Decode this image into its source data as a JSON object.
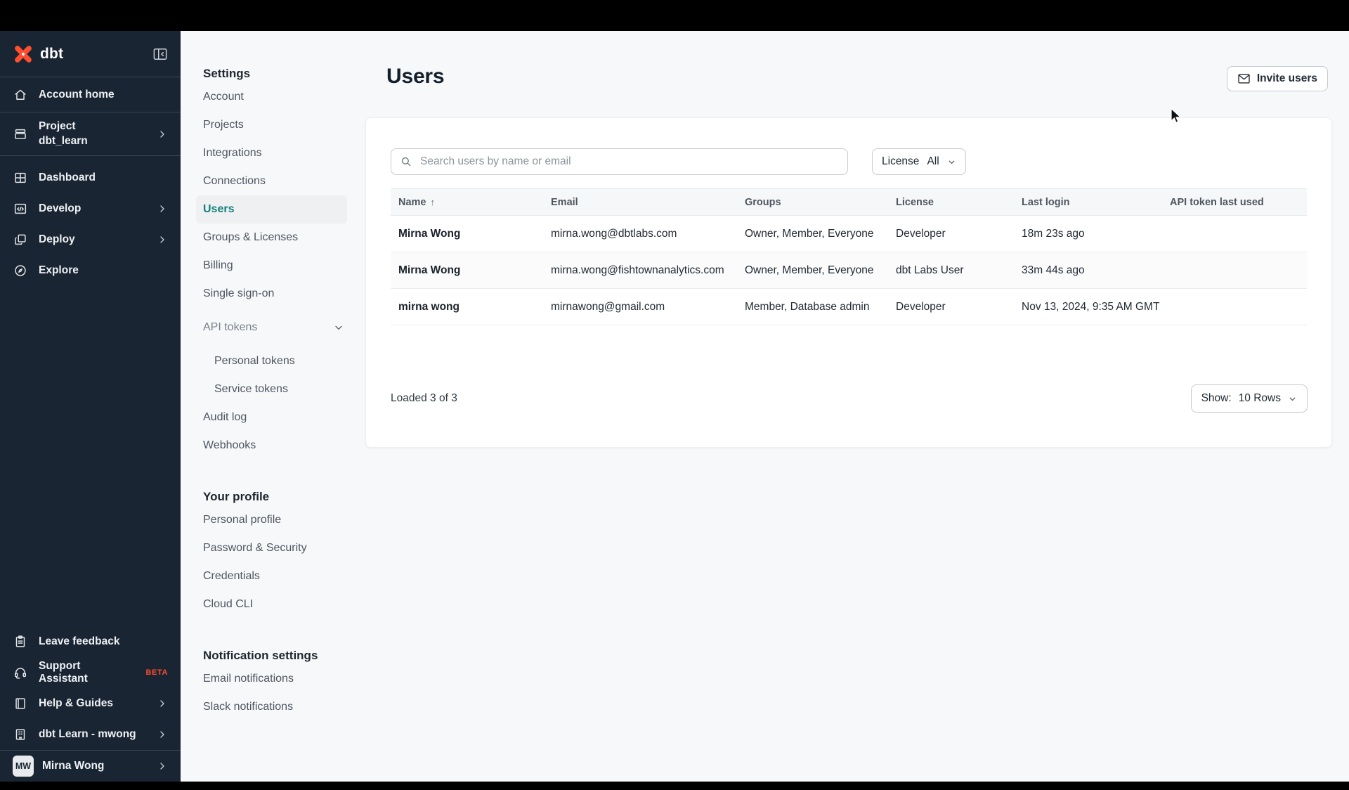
{
  "sidebar": {
    "logo_text": "dbt",
    "nav": [
      {
        "label": "Account home",
        "icon": "home"
      },
      {
        "label": "Project",
        "sublabel": "dbt_learn",
        "icon": "archive-box"
      },
      {
        "label": "Dashboard",
        "icon": "grid"
      },
      {
        "label": "Develop",
        "icon": "code-window"
      },
      {
        "label": "Deploy",
        "icon": "stacked-squares"
      },
      {
        "label": "Explore",
        "icon": "compass"
      }
    ],
    "footer_nav": [
      {
        "label": "Leave feedback",
        "icon": "clipboard"
      },
      {
        "label": "Support Assistant",
        "badge": "BETA",
        "icon": "headset"
      },
      {
        "label": "Help & Guides",
        "icon": "book"
      },
      {
        "label": "dbt Learn - mwong",
        "icon": "building"
      }
    ],
    "user": {
      "initials": "MW",
      "name": "Mirna Wong"
    }
  },
  "settings_nav": {
    "sections": [
      {
        "heading": "Settings",
        "items": [
          {
            "label": "Account"
          },
          {
            "label": "Projects"
          },
          {
            "label": "Integrations"
          },
          {
            "label": "Connections"
          },
          {
            "label": "Users",
            "active": true
          },
          {
            "label": "Groups & Licenses"
          },
          {
            "label": "Billing"
          },
          {
            "label": "Single sign-on"
          },
          {
            "label": "API tokens"
          },
          {
            "label": "Personal tokens"
          },
          {
            "label": "Service tokens"
          },
          {
            "label": "Audit log"
          },
          {
            "label": "Webhooks"
          }
        ]
      },
      {
        "heading": "Your profile",
        "items": [
          {
            "label": "Personal profile"
          },
          {
            "label": "Password & Security"
          },
          {
            "label": "Credentials"
          },
          {
            "label": "Cloud CLI"
          }
        ]
      },
      {
        "heading": "Notification settings",
        "items": [
          {
            "label": "Email notifications"
          },
          {
            "label": "Slack notifications"
          }
        ]
      }
    ]
  },
  "main": {
    "title": "Users",
    "invite_button_label": "Invite users",
    "search": {
      "placeholder": "Search users by name or email"
    },
    "license_filter": {
      "label": "License",
      "value": "All"
    },
    "table": {
      "columns": [
        {
          "label": "Name",
          "sort_icon": "↑"
        },
        {
          "label": "Email"
        },
        {
          "label": "Groups"
        },
        {
          "label": "License"
        },
        {
          "label": "Last login"
        },
        {
          "label": "API token last used"
        }
      ],
      "rows": [
        {
          "name": "Mirna Wong",
          "email": "mirna.wong@dbtlabs.com",
          "groups": "Owner, Member, Everyone",
          "license": "Developer",
          "last_login": "18m 23s ago",
          "api_token_last_used": ""
        },
        {
          "name": "Mirna Wong",
          "email": "mirna.wong@fishtownanalytics.com",
          "groups": "Owner, Member, Everyone",
          "license": "dbt Labs User",
          "last_login": "33m 44s ago",
          "api_token_last_used": ""
        },
        {
          "name": "mirna wong",
          "email": "mirnawong@gmail.com",
          "groups": "Member, Database admin",
          "license": "Developer",
          "last_login": "Nov 13, 2024, 9:35 AM GMT",
          "api_token_last_used": ""
        }
      ]
    },
    "footer": {
      "loaded_text": "Loaded 3 of 3",
      "show_label": "Show:",
      "show_value": "10 Rows"
    }
  },
  "colors": {
    "accent_orange": "#ff4f2e",
    "active_teal": "#13807a",
    "sidebar_bg": "#1a2533",
    "page_bg": "#f7f8fa"
  }
}
